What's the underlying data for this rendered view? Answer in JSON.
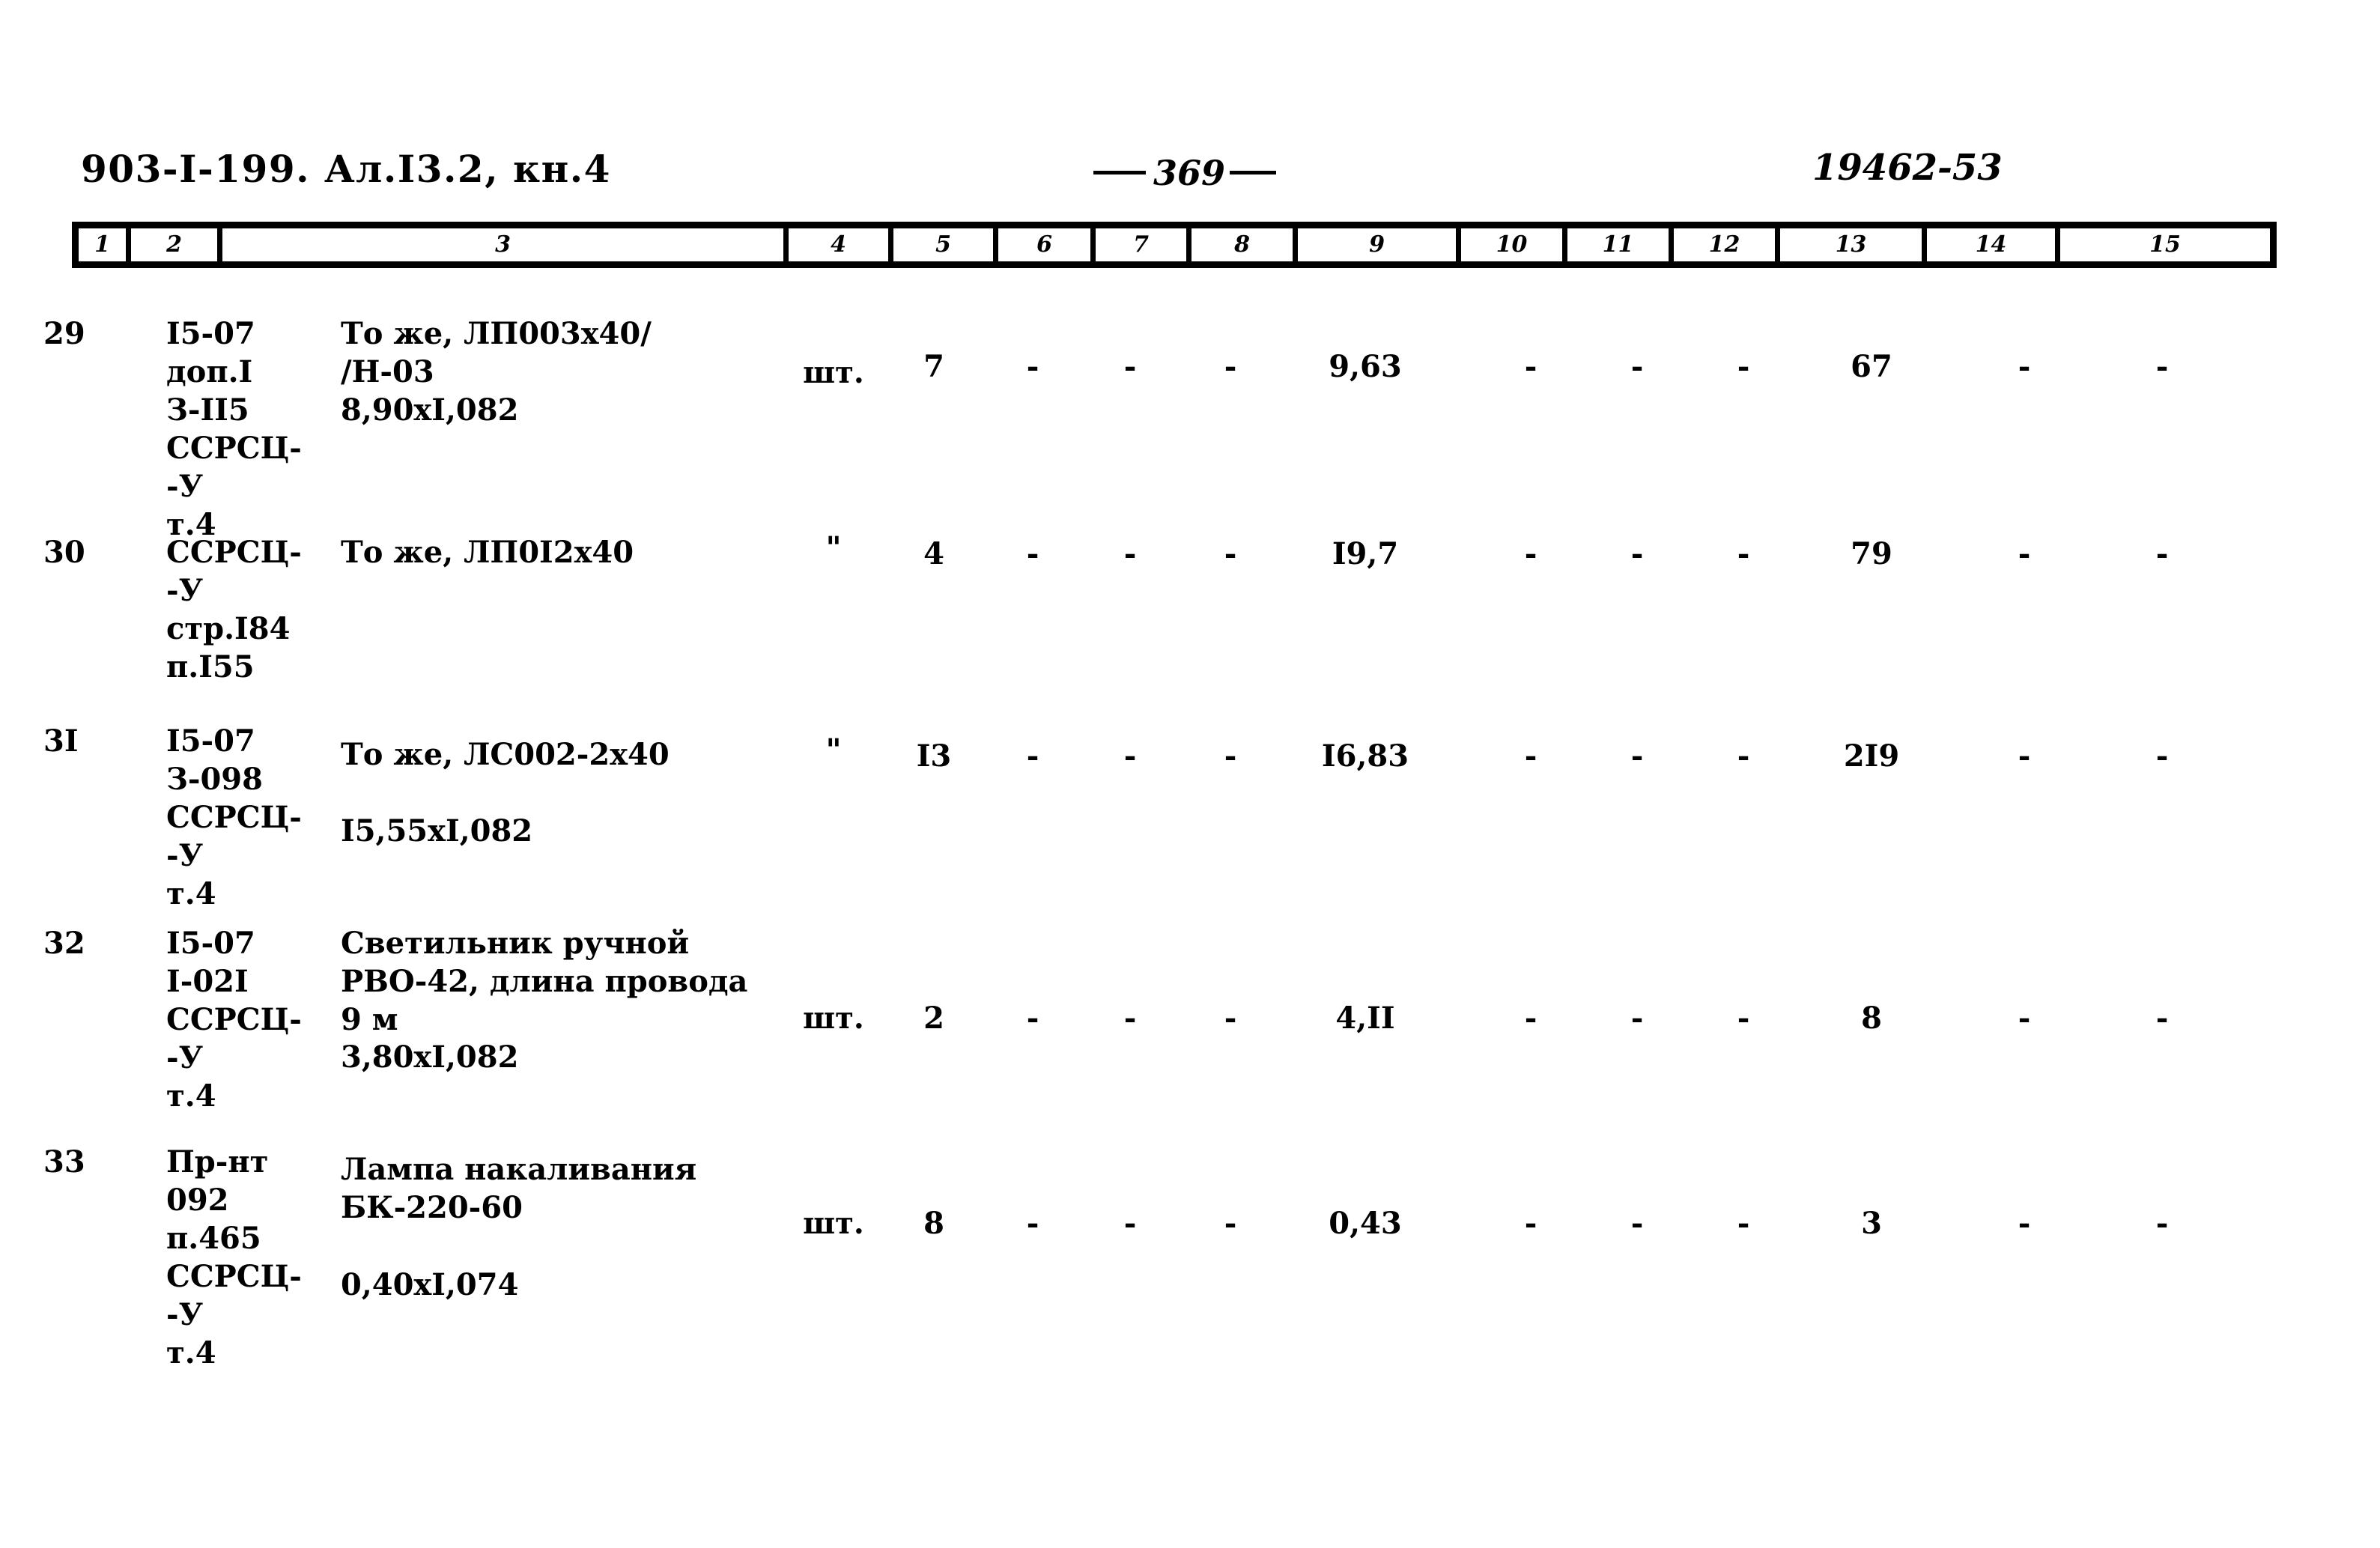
{
  "header": {
    "left": "903-I-199. Ал.I3.2, кн.4",
    "page_number": "369",
    "right": "19462-53"
  },
  "table": {
    "column_headers": [
      "1",
      "2",
      "3",
      "4",
      "5",
      "6",
      "7",
      "8",
      "9",
      "10",
      "11",
      "12",
      "13",
      "14",
      "15"
    ],
    "rows": [
      {
        "num": "29",
        "code": "I5-07\nдоп.I\nЗ-II5\nССРСЦ-\n-У\nт.4",
        "name": "То же, ЛП003х40/\n/Н-03",
        "name2": "8,90хI,082",
        "unit": "шт.",
        "qty": "7",
        "c6": "-",
        "c7": "-",
        "c8": "-",
        "c9": "9,63",
        "c10": "-",
        "c11": "-",
        "c12": "-",
        "c13": "67",
        "c14": "-",
        "c15": "-"
      },
      {
        "num": "30",
        "code": "ССРСЦ-\n-У\nстр.I84\nп.I55",
        "name": "То же, ЛП0I2х40",
        "name2": "",
        "unit": "\"",
        "qty": "4",
        "c6": "-",
        "c7": "-",
        "c8": "-",
        "c9": "I9,7",
        "c10": "-",
        "c11": "-",
        "c12": "-",
        "c13": "79",
        "c14": "-",
        "c15": "-"
      },
      {
        "num": "3I",
        "code": "I5-07\nЗ-098\nССРСЦ-\n-У\nт.4",
        "name": "То же, ЛС002-2х40",
        "name2": "I5,55хI,082",
        "unit": "\"",
        "qty": "I3",
        "c6": "-",
        "c7": "-",
        "c8": "-",
        "c9": "I6,83",
        "c10": "-",
        "c11": "-",
        "c12": "-",
        "c13": "2I9",
        "c14": "-",
        "c15": "-"
      },
      {
        "num": "32",
        "code": "I5-07\nI-02I\nССРСЦ-\n-У\nт.4",
        "name": "Светильник ручной\nРВО-42, длина провода\n9 м",
        "name2": "3,80хI,082",
        "unit": "шт.",
        "qty": "2",
        "c6": "-",
        "c7": "-",
        "c8": "-",
        "c9": "4,II",
        "c10": "-",
        "c11": "-",
        "c12": "-",
        "c13": "8",
        "c14": "-",
        "c15": "-"
      },
      {
        "num": "33",
        "code": "Пр-нт\n092\nп.465\nССРСЦ-\n-У\nт.4",
        "name": "Лампа накаливания\nБК-220-60",
        "name2": "0,40хI,074",
        "unit": "шт.",
        "qty": "8",
        "c6": "-",
        "c7": "-",
        "c8": "-",
        "c9": "0,43",
        "c10": "-",
        "c11": "-",
        "c12": "-",
        "c13": "3",
        "c14": "-",
        "c15": "-"
      }
    ]
  }
}
